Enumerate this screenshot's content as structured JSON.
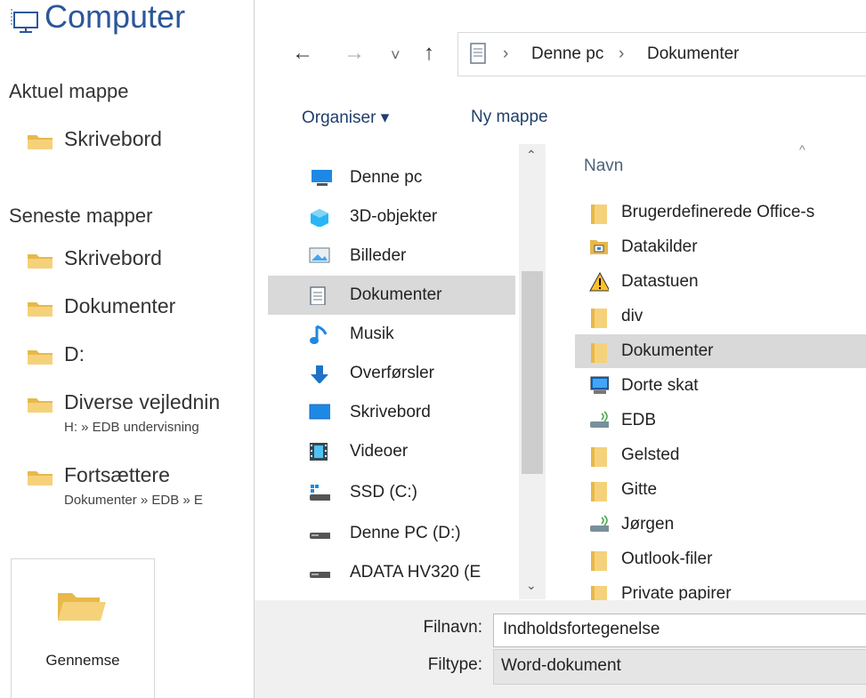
{
  "backstage": {
    "title": "Computer",
    "current_folder_heading": "Aktuel mappe",
    "current_folder": "Skrivebord",
    "recent_heading": "Seneste mapper",
    "recent": [
      {
        "label": "Skrivebord",
        "sub": ""
      },
      {
        "label": "Dokumenter",
        "sub": ""
      },
      {
        "label": "D:",
        "sub": ""
      },
      {
        "label": "Diverse vejlednin",
        "sub": "H: » EDB undervisning"
      },
      {
        "label": "Fortsættere",
        "sub": "Dokumenter » EDB » E"
      }
    ],
    "browse_label": "Gennemse"
  },
  "dialog": {
    "nav": {
      "back": "←",
      "forward": "→",
      "recent": "˅",
      "up": "↑"
    },
    "breadcrumb": [
      "Denne pc",
      "Dokumenter"
    ],
    "breadcrumb_sep": "›",
    "toolbar": {
      "organize": "Organiser ▾",
      "new_folder": "Ny mappe"
    },
    "nav_pane": [
      {
        "label": "Denne pc",
        "icon": "pc-icon"
      },
      {
        "label": "3D-objekter",
        "icon": "3d-objects-icon"
      },
      {
        "label": "Billeder",
        "icon": "pictures-icon"
      },
      {
        "label": "Dokumenter",
        "icon": "documents-icon",
        "selected": true
      },
      {
        "label": "Musik",
        "icon": "music-icon"
      },
      {
        "label": "Overførsler",
        "icon": "downloads-icon"
      },
      {
        "label": "Skrivebord",
        "icon": "desktop-icon"
      },
      {
        "label": "Videoer",
        "icon": "videos-icon"
      },
      {
        "label": "SSD (C:)",
        "icon": "system-drive-icon"
      },
      {
        "label": "Denne PC (D:)",
        "icon": "drive-icon"
      },
      {
        "label": "ADATA HV320 (E",
        "icon": "drive-icon"
      }
    ],
    "column_header": "Navn",
    "files": [
      {
        "label": "Brugerdefinerede Office-s",
        "icon": "folder-icon"
      },
      {
        "label": "Datakilder",
        "icon": "data-sources-folder-icon"
      },
      {
        "label": "Datastuen",
        "icon": "warning-icon"
      },
      {
        "label": "div",
        "icon": "folder-icon"
      },
      {
        "label": "Dokumenter",
        "icon": "folder-icon",
        "selected": true
      },
      {
        "label": "Dorte skat",
        "icon": "monitor-icon"
      },
      {
        "label": "EDB",
        "icon": "network-drive-icon"
      },
      {
        "label": "Gelsted",
        "icon": "folder-icon"
      },
      {
        "label": "Gitte",
        "icon": "folder-icon"
      },
      {
        "label": "Jørgen",
        "icon": "network-drive-icon"
      },
      {
        "label": "Outlook-filer",
        "icon": "folder-icon"
      },
      {
        "label": "Private papirer",
        "icon": "folder-icon"
      }
    ],
    "filename_label": "Filnavn:",
    "filename_value": "Indholdsfortegenelse",
    "filetype_label": "Filtype:",
    "filetype_value": "Word-dokument"
  },
  "colors": {
    "accent": "#2b579a",
    "folder": "#f5d27a",
    "selection": "#d9d9d9"
  }
}
